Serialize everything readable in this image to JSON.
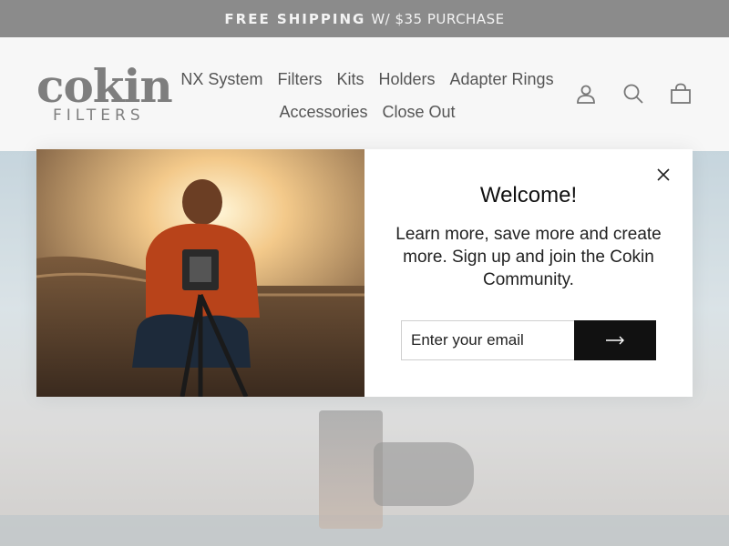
{
  "announcement": {
    "bold": "FREE SHIPPING",
    "rest": "W/ $35 PURCHASE"
  },
  "logo": {
    "word": "cokin",
    "sub": "FILTERS"
  },
  "nav": {
    "row1": [
      "NX System",
      "Filters",
      "Kits",
      "Holders",
      "Adapter Rings"
    ],
    "row2": [
      "Accessories",
      "Close Out"
    ]
  },
  "header_icons": [
    "account-icon",
    "search-icon",
    "cart-icon"
  ],
  "popup": {
    "title": "Welcome!",
    "text": "Learn more, save more and create more. Sign up and join the Cokin Community.",
    "email_placeholder": "Enter your email",
    "submit_icon": "arrow-right-icon",
    "close_icon": "close-icon"
  },
  "colors": {
    "announcement_bg": "#8b8b8b",
    "header_bg": "#f7f7f7",
    "button_bg": "#111111",
    "text": "#555555"
  }
}
